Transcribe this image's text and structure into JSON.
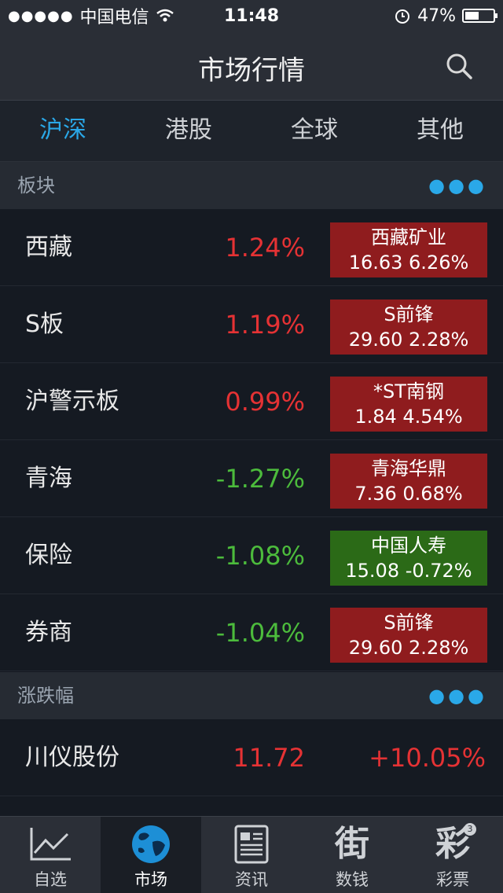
{
  "status_bar": {
    "signal": "●●●●●",
    "carrier": "中国电信",
    "time": "11:48",
    "battery_percent": "47%"
  },
  "nav": {
    "title": "市场行情"
  },
  "tabs": [
    "沪深",
    "港股",
    "全球",
    "其他"
  ],
  "sections": {
    "sectors": {
      "title": "板块",
      "more": "●●●"
    },
    "movers": {
      "title": "涨跌幅",
      "more": "●●●"
    }
  },
  "sector_rows": [
    {
      "name": "西藏",
      "pct": "1.24%",
      "stock": "西藏矿业",
      "stock_quote": "16.63 6.26%"
    },
    {
      "name": "S板",
      "pct": "1.19%",
      "stock": "S前锋",
      "stock_quote": "29.60 2.28%"
    },
    {
      "name": "沪警示板",
      "pct": "0.99%",
      "stock": "*ST南钢",
      "stock_quote": "1.84 4.54%"
    },
    {
      "name": "青海",
      "pct": "-1.27%",
      "stock": "青海华鼎",
      "stock_quote": "7.36 0.68%"
    },
    {
      "name": "保险",
      "pct": "-1.08%",
      "stock": "中国人寿",
      "stock_quote": "15.08 -0.72%"
    },
    {
      "name": "券商",
      "pct": "-1.04%",
      "stock": "S前锋",
      "stock_quote": "29.60 2.28%"
    }
  ],
  "mover_rows": [
    {
      "name": "川仪股份",
      "price": "11.72",
      "change": "+10.05%"
    }
  ],
  "tabbar": [
    {
      "label": "自选",
      "icon": "chart-line-icon"
    },
    {
      "label": "市场",
      "icon": "globe-icon"
    },
    {
      "label": "资讯",
      "icon": "news-icon"
    },
    {
      "label": "数钱",
      "icon": "jie-char-icon",
      "glyph": "街"
    },
    {
      "label": "彩票",
      "icon": "cai-char-icon",
      "glyph": "彩",
      "badge": "3"
    }
  ],
  "colors": {
    "accent": "#2aa8e8",
    "up": "#e53234",
    "down": "#4cbb3c",
    "up_box": "#8f1c1e",
    "down_box": "#2b6a17"
  }
}
